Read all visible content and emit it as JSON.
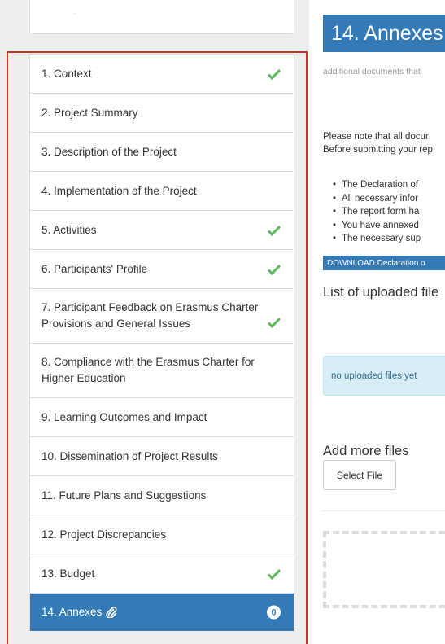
{
  "sidebar": {
    "items": [
      {
        "label": "1. Context",
        "done": true
      },
      {
        "label": "2. Project Summary",
        "done": false
      },
      {
        "label": "3. Description of the Project",
        "done": false
      },
      {
        "label": "4. Implementation of the Project",
        "done": false
      },
      {
        "label": "5. Activities",
        "done": true
      },
      {
        "label": "6. Participants' Profile",
        "done": true
      },
      {
        "label": "7. Participant Feedback on Erasmus Charter Provisions and General Issues",
        "done": true
      },
      {
        "label": "8. Compliance with the Erasmus Charter for Higher Education",
        "done": false
      },
      {
        "label": "9. Learning Outcomes and Impact",
        "done": false
      },
      {
        "label": "10. Dissemination of Project Results",
        "done": false
      },
      {
        "label": "11. Future Plans and Suggestions",
        "done": false
      },
      {
        "label": "12. Project Discrepancies",
        "done": false
      },
      {
        "label": "13. Budget",
        "done": true
      },
      {
        "label": "14. Annexes",
        "done": false,
        "active": true,
        "badge": "0",
        "icon": "paperclip-icon"
      }
    ],
    "check_icon": "check-icon",
    "check_color": "#5cb85c"
  },
  "main": {
    "title": "14. Annexes",
    "subtitle": "additional documents that",
    "note_line1": "Please note that all docur",
    "note_line2": "Before submitting your rep",
    "bullets": [
      "The Declaration of",
      "All necessary infor",
      "The report form ha",
      "You have annexed",
      "The necessary sup"
    ],
    "download_label": "DOWNLOAD Declaration o",
    "uploaded_heading": "List of uploaded file",
    "no_files_text": "no uploaded files yet",
    "add_heading": "Add more files",
    "select_label": "Select File"
  },
  "colors": {
    "primary": "#337ab7",
    "highlight_border": "#c9312b",
    "info_bg": "#d9edf7"
  }
}
